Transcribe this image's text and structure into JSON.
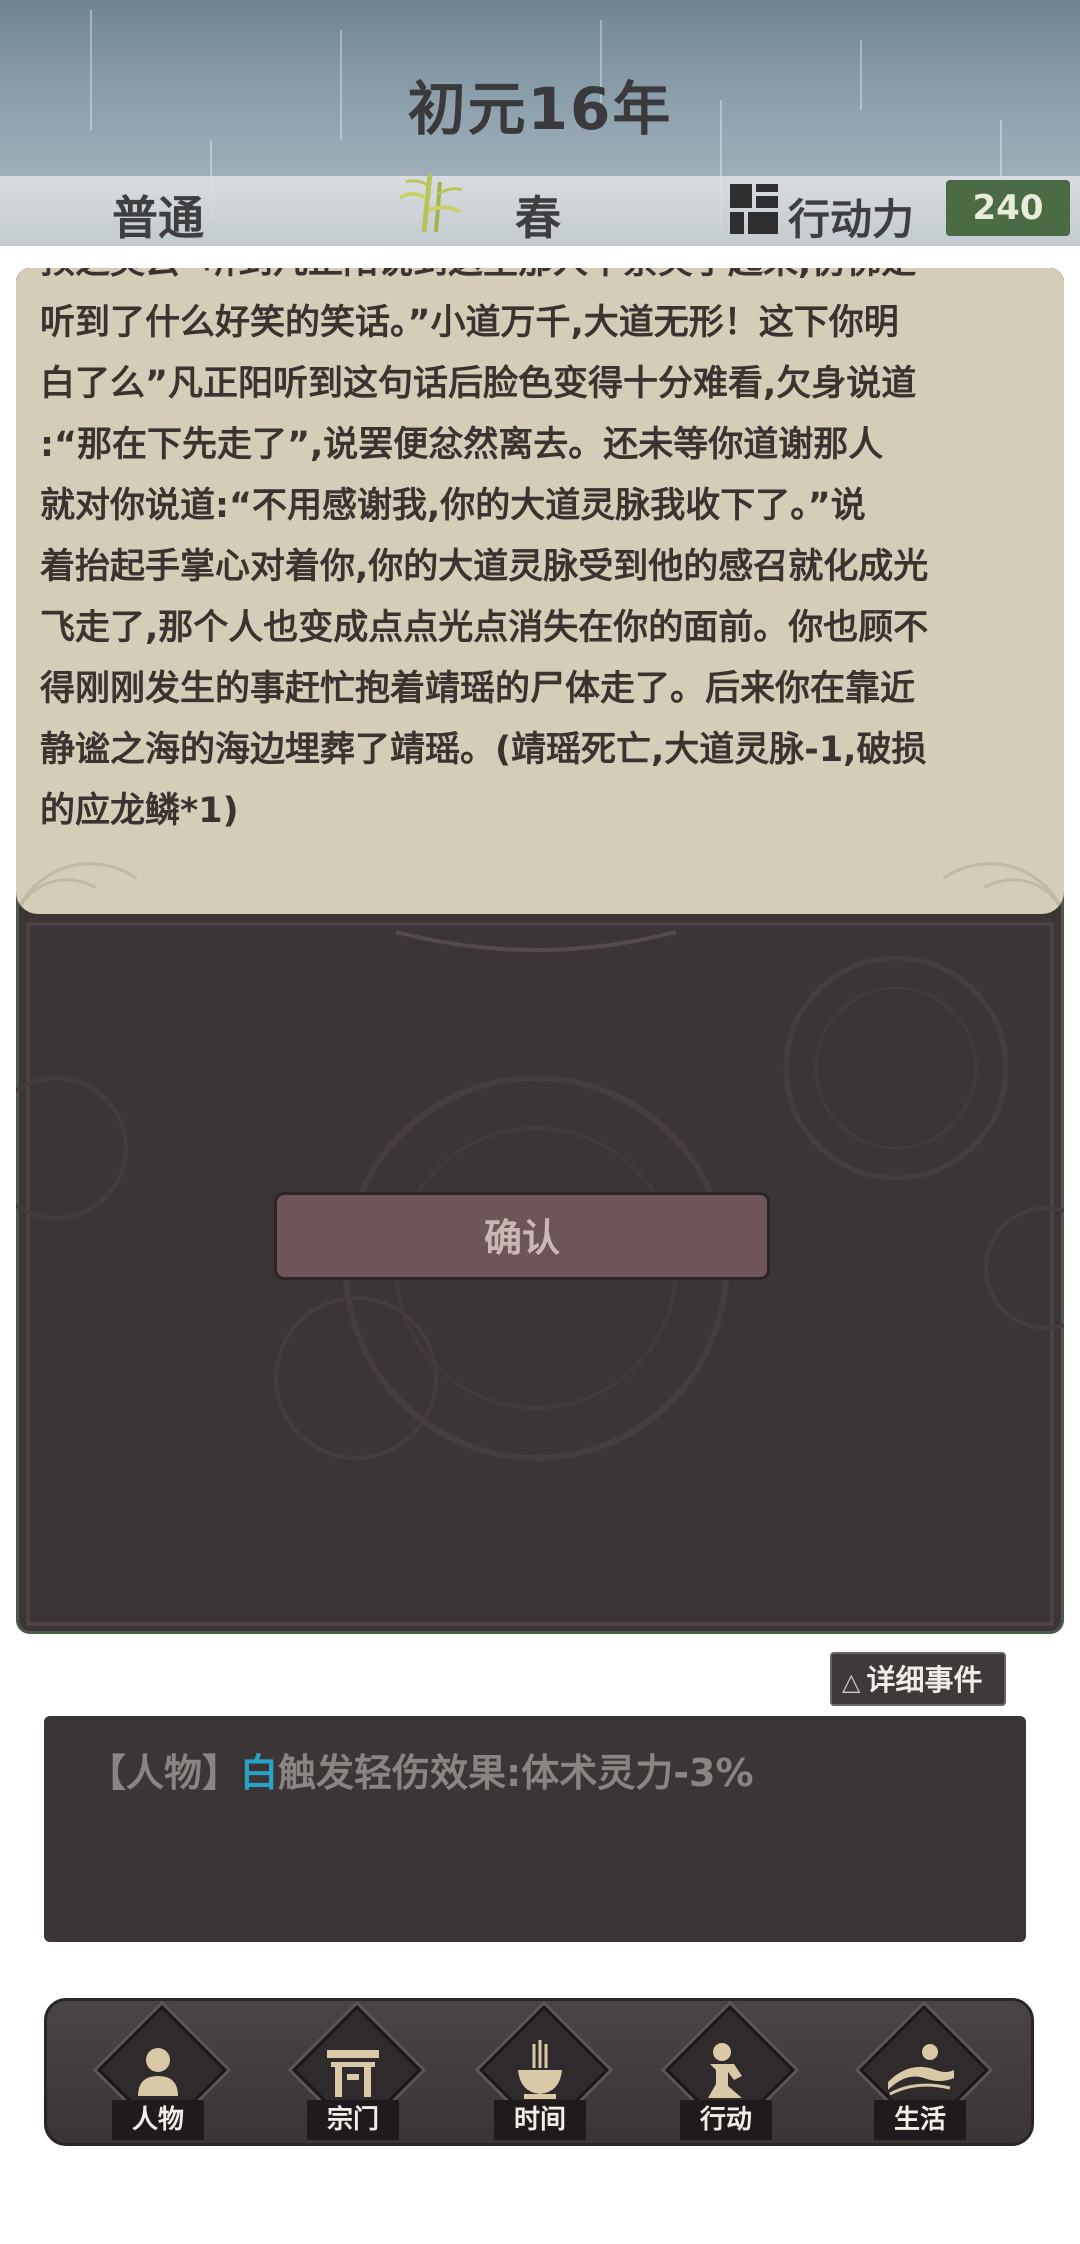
{
  "header": {
    "title": "初元16年",
    "mode": "普通",
    "season": "春",
    "action_label": "行动力",
    "action_value": "240"
  },
  "event": {
    "text_lines": [
      "预之灵云“听到凡正阳说到这里那人不禁笑了起来,仿佛是",
      "听到了什么好笑的笑话。”小道万千,大道无形！这下你明",
      "白了么”凡正阳听到这句话后脸色变得十分难看,欠身说道",
      ":“那在下先走了”,说罢便忿然离去。还未等你道谢那人",
      "就对你说道:“不用感谢我,你的大道灵脉我收下了。”说",
      "着抬起手掌心对着你,你的大道灵脉受到他的感召就化成光",
      "飞走了,那个人也变成点点光点消失在你的面前。你也顾不",
      "得刚刚发生的事赶忙抱着靖瑶的尸体走了。后来你在靠近",
      "静谧之海的海边埋葬了靖瑶。(靖瑶死亡,大道灵脉-1,破损",
      "的应龙鳞*1)"
    ],
    "confirm_label": "确认"
  },
  "detail_button": {
    "icon": "triangle-icon",
    "label": "详细事件"
  },
  "log": {
    "prefix": "【人物】",
    "highlight": "白",
    "text": "触发轻伤效果:体术灵力-3%"
  },
  "nav": {
    "items": [
      {
        "label": "人物",
        "icon": "person-icon"
      },
      {
        "label": "宗门",
        "icon": "sect-gate-icon"
      },
      {
        "label": "时间",
        "icon": "incense-burner-icon"
      },
      {
        "label": "行动",
        "icon": "action-figure-icon"
      },
      {
        "label": "生活",
        "icon": "life-landscape-icon"
      }
    ]
  },
  "colors": {
    "accent_green": "#4a6b43",
    "panel_dark": "#3c3536",
    "parchment": "#d6cdb8",
    "highlight_blue": "#26a3c7"
  }
}
